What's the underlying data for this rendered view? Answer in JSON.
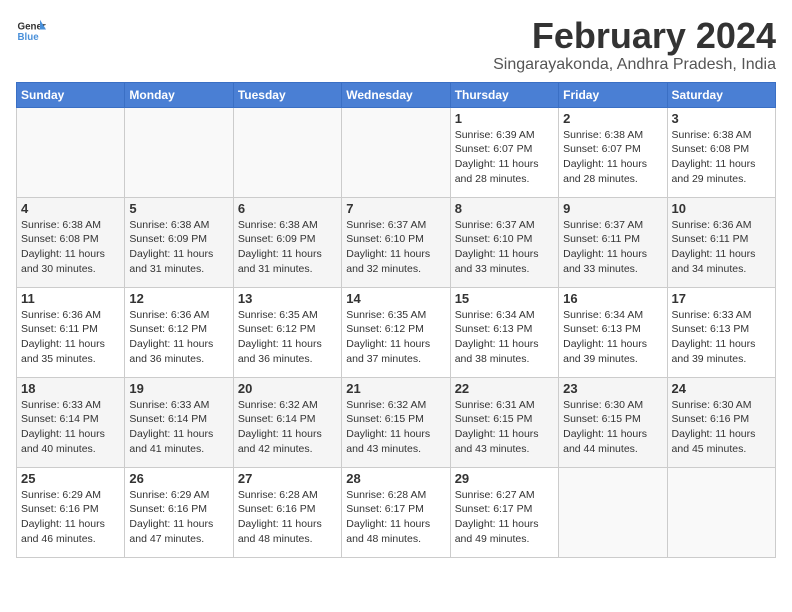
{
  "header": {
    "logo_line1": "General",
    "logo_line2": "Blue",
    "title": "February 2024",
    "subtitle": "Singarayakonda, Andhra Pradesh, India"
  },
  "weekdays": [
    "Sunday",
    "Monday",
    "Tuesday",
    "Wednesday",
    "Thursday",
    "Friday",
    "Saturday"
  ],
  "weeks": [
    [
      {
        "day": "",
        "info": ""
      },
      {
        "day": "",
        "info": ""
      },
      {
        "day": "",
        "info": ""
      },
      {
        "day": "",
        "info": ""
      },
      {
        "day": "1",
        "info": "Sunrise: 6:39 AM\nSunset: 6:07 PM\nDaylight: 11 hours\nand 28 minutes."
      },
      {
        "day": "2",
        "info": "Sunrise: 6:38 AM\nSunset: 6:07 PM\nDaylight: 11 hours\nand 28 minutes."
      },
      {
        "day": "3",
        "info": "Sunrise: 6:38 AM\nSunset: 6:08 PM\nDaylight: 11 hours\nand 29 minutes."
      }
    ],
    [
      {
        "day": "4",
        "info": "Sunrise: 6:38 AM\nSunset: 6:08 PM\nDaylight: 11 hours\nand 30 minutes."
      },
      {
        "day": "5",
        "info": "Sunrise: 6:38 AM\nSunset: 6:09 PM\nDaylight: 11 hours\nand 31 minutes."
      },
      {
        "day": "6",
        "info": "Sunrise: 6:38 AM\nSunset: 6:09 PM\nDaylight: 11 hours\nand 31 minutes."
      },
      {
        "day": "7",
        "info": "Sunrise: 6:37 AM\nSunset: 6:10 PM\nDaylight: 11 hours\nand 32 minutes."
      },
      {
        "day": "8",
        "info": "Sunrise: 6:37 AM\nSunset: 6:10 PM\nDaylight: 11 hours\nand 33 minutes."
      },
      {
        "day": "9",
        "info": "Sunrise: 6:37 AM\nSunset: 6:11 PM\nDaylight: 11 hours\nand 33 minutes."
      },
      {
        "day": "10",
        "info": "Sunrise: 6:36 AM\nSunset: 6:11 PM\nDaylight: 11 hours\nand 34 minutes."
      }
    ],
    [
      {
        "day": "11",
        "info": "Sunrise: 6:36 AM\nSunset: 6:11 PM\nDaylight: 11 hours\nand 35 minutes."
      },
      {
        "day": "12",
        "info": "Sunrise: 6:36 AM\nSunset: 6:12 PM\nDaylight: 11 hours\nand 36 minutes."
      },
      {
        "day": "13",
        "info": "Sunrise: 6:35 AM\nSunset: 6:12 PM\nDaylight: 11 hours\nand 36 minutes."
      },
      {
        "day": "14",
        "info": "Sunrise: 6:35 AM\nSunset: 6:12 PM\nDaylight: 11 hours\nand 37 minutes."
      },
      {
        "day": "15",
        "info": "Sunrise: 6:34 AM\nSunset: 6:13 PM\nDaylight: 11 hours\nand 38 minutes."
      },
      {
        "day": "16",
        "info": "Sunrise: 6:34 AM\nSunset: 6:13 PM\nDaylight: 11 hours\nand 39 minutes."
      },
      {
        "day": "17",
        "info": "Sunrise: 6:33 AM\nSunset: 6:13 PM\nDaylight: 11 hours\nand 39 minutes."
      }
    ],
    [
      {
        "day": "18",
        "info": "Sunrise: 6:33 AM\nSunset: 6:14 PM\nDaylight: 11 hours\nand 40 minutes."
      },
      {
        "day": "19",
        "info": "Sunrise: 6:33 AM\nSunset: 6:14 PM\nDaylight: 11 hours\nand 41 minutes."
      },
      {
        "day": "20",
        "info": "Sunrise: 6:32 AM\nSunset: 6:14 PM\nDaylight: 11 hours\nand 42 minutes."
      },
      {
        "day": "21",
        "info": "Sunrise: 6:32 AM\nSunset: 6:15 PM\nDaylight: 11 hours\nand 43 minutes."
      },
      {
        "day": "22",
        "info": "Sunrise: 6:31 AM\nSunset: 6:15 PM\nDaylight: 11 hours\nand 43 minutes."
      },
      {
        "day": "23",
        "info": "Sunrise: 6:30 AM\nSunset: 6:15 PM\nDaylight: 11 hours\nand 44 minutes."
      },
      {
        "day": "24",
        "info": "Sunrise: 6:30 AM\nSunset: 6:16 PM\nDaylight: 11 hours\nand 45 minutes."
      }
    ],
    [
      {
        "day": "25",
        "info": "Sunrise: 6:29 AM\nSunset: 6:16 PM\nDaylight: 11 hours\nand 46 minutes."
      },
      {
        "day": "26",
        "info": "Sunrise: 6:29 AM\nSunset: 6:16 PM\nDaylight: 11 hours\nand 47 minutes."
      },
      {
        "day": "27",
        "info": "Sunrise: 6:28 AM\nSunset: 6:16 PM\nDaylight: 11 hours\nand 48 minutes."
      },
      {
        "day": "28",
        "info": "Sunrise: 6:28 AM\nSunset: 6:17 PM\nDaylight: 11 hours\nand 48 minutes."
      },
      {
        "day": "29",
        "info": "Sunrise: 6:27 AM\nSunset: 6:17 PM\nDaylight: 11 hours\nand 49 minutes."
      },
      {
        "day": "",
        "info": ""
      },
      {
        "day": "",
        "info": ""
      }
    ]
  ]
}
